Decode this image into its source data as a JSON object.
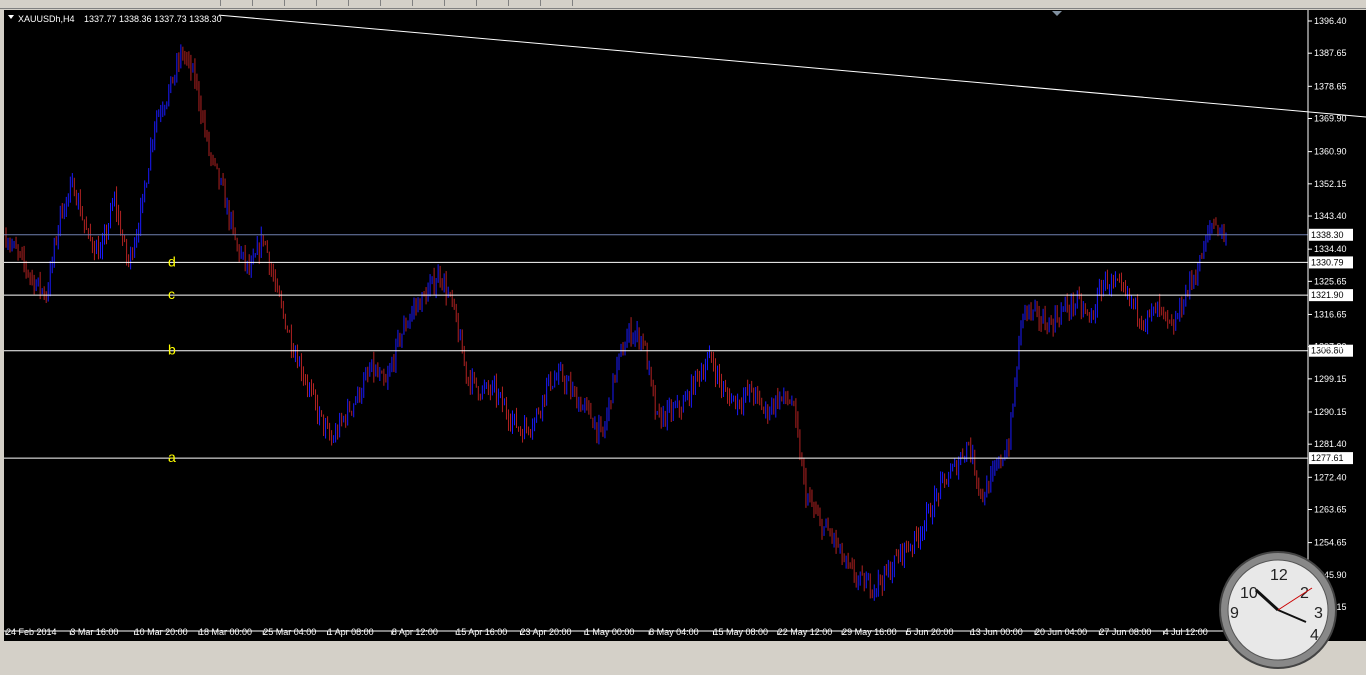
{
  "header": {
    "symbol": "XAUUSDh,H4",
    "ohlc": "1337.77 1338.36 1337.73 1338.30"
  },
  "colors": {
    "background": "#000000",
    "up_candle": "#1a1aff",
    "down_candle": "#b22222",
    "axis_text": "#ffffff",
    "level_line": "#ffffff",
    "level_label": "#ffff00",
    "current_price_line": "#7080b0"
  },
  "chart_data": {
    "type": "candlestick",
    "ylim": [
      1237.15,
      1396.4
    ],
    "y_ticks": [
      1396.4,
      1387.65,
      1378.65,
      1369.9,
      1360.9,
      1352.15,
      1343.4,
      1334.4,
      1325.65,
      1316.65,
      1307.9,
      1299.15,
      1290.15,
      1281.4,
      1272.4,
      1263.65,
      1254.65,
      1245.9,
      1237.15
    ],
    "x_ticks": [
      "24 Feb 2014",
      "3 Mar 16:00",
      "10 Mar 20:00",
      "18 Mar 00:00",
      "25 Mar 04:00",
      "1 Apr 08:00",
      "8 Apr 12:00",
      "15 Apr 16:00",
      "23 Apr 20:00",
      "1 May 00:00",
      "8 May 04:00",
      "15 May 08:00",
      "22 May 12:00",
      "29 May 16:00",
      "5 Jun 20:00",
      "13 Jun 00:00",
      "20 Jun 04:00",
      "27 Jun 08:00",
      "4 Jul 12:00",
      "11 Jul 20:00"
    ],
    "current_price": 1338.3,
    "horizontal_levels": [
      {
        "label": "d",
        "price": 1330.79
      },
      {
        "label": "c",
        "price": 1321.9
      },
      {
        "label": "b",
        "price": 1306.8
      },
      {
        "label": "a",
        "price": 1277.61
      }
    ],
    "trendline": {
      "start_price": 1398.0,
      "end_price": 1370.3
    },
    "price_path": [
      {
        "date": "24 Feb 2014",
        "price": 1338
      },
      {
        "date": "26 Feb",
        "price": 1332
      },
      {
        "date": "27 Feb",
        "price": 1326
      },
      {
        "date": "28 Feb",
        "price": 1322
      },
      {
        "date": "1 Mar",
        "price": 1344
      },
      {
        "date": "2 Mar",
        "price": 1352
      },
      {
        "date": "3 Mar 16:00",
        "price": 1338
      },
      {
        "date": "5 Mar",
        "price": 1333
      },
      {
        "date": "7 Mar",
        "price": 1348
      },
      {
        "date": "8 Mar",
        "price": 1330
      },
      {
        "date": "9 Mar",
        "price": 1345
      },
      {
        "date": "10 Mar 20:00",
        "price": 1370
      },
      {
        "date": "12 Mar",
        "price": 1377
      },
      {
        "date": "13 Mar",
        "price": 1388
      },
      {
        "date": "14 Mar",
        "price": 1380
      },
      {
        "date": "16 Mar",
        "price": 1360
      },
      {
        "date": "17 Mar",
        "price": 1350
      },
      {
        "date": "18 Mar 00:00",
        "price": 1335
      },
      {
        "date": "19 Mar",
        "price": 1328
      },
      {
        "date": "20 Mar",
        "price": 1338
      },
      {
        "date": "22 Mar",
        "price": 1322
      },
      {
        "date": "25 Mar 04:00",
        "price": 1310
      },
      {
        "date": "27 Mar",
        "price": 1300
      },
      {
        "date": "29 Mar",
        "price": 1290
      },
      {
        "date": "31 Mar",
        "price": 1282
      },
      {
        "date": "1 Apr 08:00",
        "price": 1289
      },
      {
        "date": "3 Apr",
        "price": 1295
      },
      {
        "date": "4 Apr",
        "price": 1302
      },
      {
        "date": "5 Apr",
        "price": 1297
      },
      {
        "date": "7 Apr",
        "price": 1310
      },
      {
        "date": "8 Apr 12:00",
        "price": 1318
      },
      {
        "date": "10 Apr",
        "price": 1322
      },
      {
        "date": "11 Apr",
        "price": 1328
      },
      {
        "date": "13 Apr",
        "price": 1318
      },
      {
        "date": "14 Apr",
        "price": 1300
      },
      {
        "date": "15 Apr 16:00",
        "price": 1296
      },
      {
        "date": "17 Apr",
        "price": 1296
      },
      {
        "date": "19 Apr",
        "price": 1290
      },
      {
        "date": "21 Apr",
        "price": 1285
      },
      {
        "date": "22 Apr",
        "price": 1288
      },
      {
        "date": "23 Apr 20:00",
        "price": 1298
      },
      {
        "date": "25 Apr",
        "price": 1300
      },
      {
        "date": "27 Apr",
        "price": 1294
      },
      {
        "date": "28 Apr",
        "price": 1290
      },
      {
        "date": "30 Apr",
        "price": 1283
      },
      {
        "date": "1 May 00:00",
        "price": 1302
      },
      {
        "date": "3 May",
        "price": 1312
      },
      {
        "date": "5 May",
        "price": 1310
      },
      {
        "date": "7 May",
        "price": 1288
      },
      {
        "date": "8 May 04:00",
        "price": 1290
      },
      {
        "date": "10 May",
        "price": 1292
      },
      {
        "date": "12 May",
        "price": 1300
      },
      {
        "date": "13 May",
        "price": 1305
      },
      {
        "date": "15 May 08:00",
        "price": 1295
      },
      {
        "date": "17 May",
        "price": 1293
      },
      {
        "date": "19 May",
        "price": 1296
      },
      {
        "date": "21 May",
        "price": 1290
      },
      {
        "date": "22 May 12:00",
        "price": 1294
      },
      {
        "date": "24 May",
        "price": 1293
      },
      {
        "date": "25 May",
        "price": 1268
      },
      {
        "date": "27 May",
        "price": 1260
      },
      {
        "date": "28 May",
        "price": 1256
      },
      {
        "date": "29 May 16:00",
        "price": 1248
      },
      {
        "date": "31 May",
        "price": 1244
      },
      {
        "date": "2 Jun",
        "price": 1243
      },
      {
        "date": "3 Jun",
        "price": 1246
      },
      {
        "date": "5 Jun 20:00",
        "price": 1252
      },
      {
        "date": "7 Jun",
        "price": 1255
      },
      {
        "date": "9 Jun",
        "price": 1262
      },
      {
        "date": "10 Jun",
        "price": 1270
      },
      {
        "date": "11 Jun",
        "price": 1275
      },
      {
        "date": "12 Jun",
        "price": 1282
      },
      {
        "date": "13 Jun 00:00",
        "price": 1267
      },
      {
        "date": "14 Jun",
        "price": 1274
      },
      {
        "date": "16 Jun",
        "price": 1282
      },
      {
        "date": "18 Jun",
        "price": 1318
      },
      {
        "date": "20 Jun 04:00",
        "price": 1316
      },
      {
        "date": "21 Jun",
        "price": 1314
      },
      {
        "date": "23 Jun",
        "price": 1318
      },
      {
        "date": "25 Jun",
        "price": 1320
      },
      {
        "date": "26 Jun",
        "price": 1315
      },
      {
        "date": "27 Jun 08:00",
        "price": 1326
      },
      {
        "date": "28 Jun",
        "price": 1324
      },
      {
        "date": "30 Jun",
        "price": 1320
      },
      {
        "date": "1 Jul",
        "price": 1315
      },
      {
        "date": "2 Jul",
        "price": 1318
      },
      {
        "date": "3 Jul",
        "price": 1312
      },
      {
        "date": "4 Jul 12:00",
        "price": 1322
      },
      {
        "date": "6 Jul",
        "price": 1330
      },
      {
        "date": "7 Jul",
        "price": 1342
      },
      {
        "date": "8 Jul",
        "price": 1338
      }
    ]
  }
}
